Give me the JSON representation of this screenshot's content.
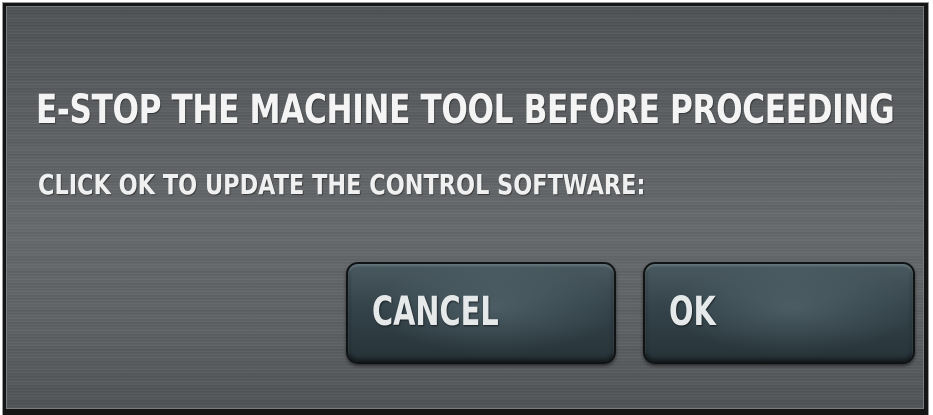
{
  "dialog": {
    "heading": "E-STOP THE MACHINE TOOL BEFORE PROCEEDING",
    "message": "CLICK OK TO UPDATE THE CONTROL SOFTWARE:",
    "buttons": {
      "cancel_label": "CANCEL",
      "ok_label": "OK"
    }
  },
  "colors": {
    "panel": "#5c5f62",
    "text": "#f4f4f4",
    "button": "#34434a",
    "border": "#151515"
  }
}
